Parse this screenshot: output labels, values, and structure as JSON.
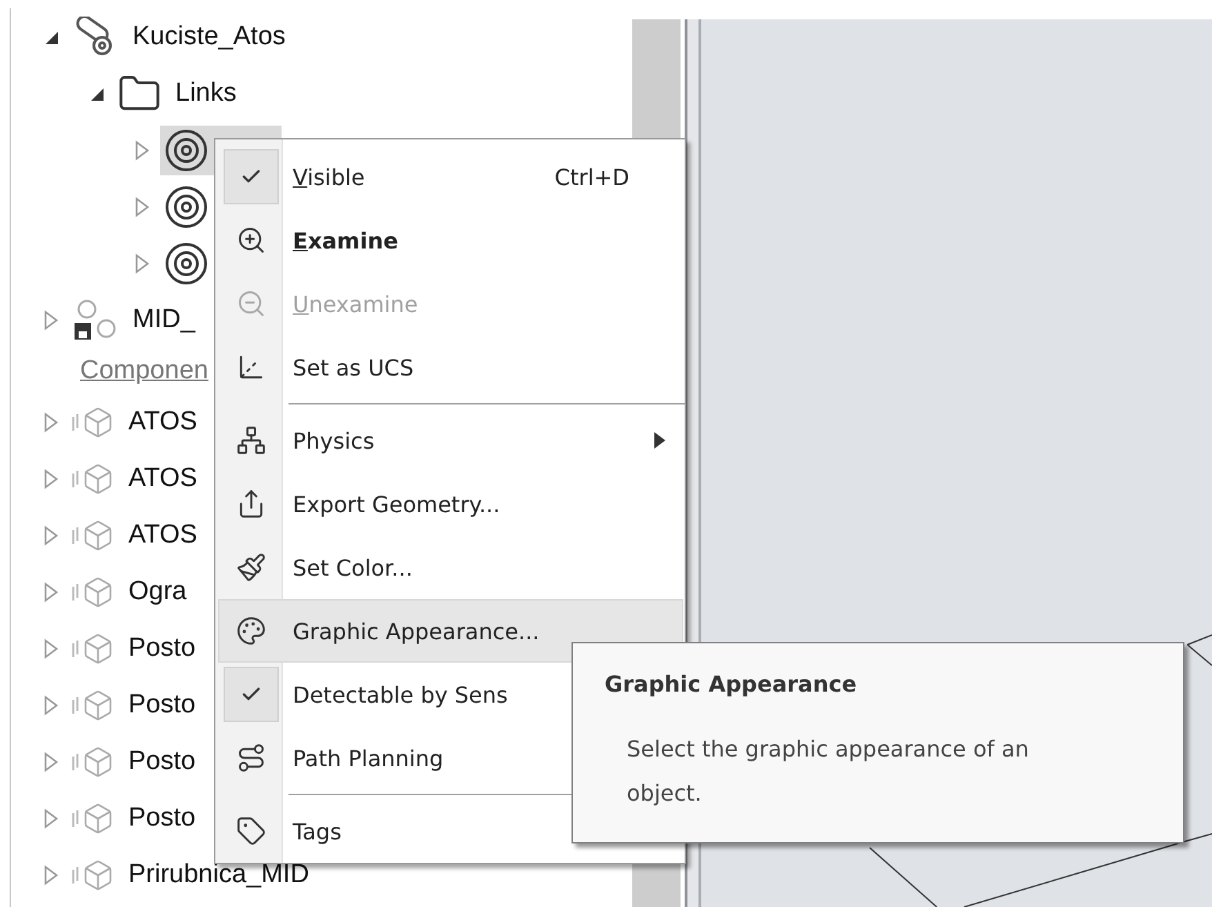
{
  "tree": [
    {
      "kind": "assembly",
      "label": "Kuciste_Atos",
      "expanded": true,
      "selected": false,
      "children": [
        {
          "kind": "folder",
          "label": "Links",
          "expanded": true,
          "selected": false,
          "children": [
            {
              "kind": "link",
              "expanded": false,
              "selected": true
            },
            {
              "kind": "link",
              "expanded": false,
              "selected": false
            },
            {
              "kind": "link",
              "expanded": false,
              "selected": false
            }
          ]
        }
      ]
    },
    {
      "kind": "saved-assembly",
      "label": "MID_",
      "expanded": false,
      "selected": false
    },
    {
      "kind": "caption",
      "label": "Componen"
    },
    {
      "kind": "component",
      "label": "ATOS",
      "expanded": false,
      "selected": false
    },
    {
      "kind": "component",
      "label": "ATOS",
      "expanded": false,
      "selected": false
    },
    {
      "kind": "component",
      "label": "ATOS",
      "expanded": false,
      "selected": false
    },
    {
      "kind": "component",
      "label": "Ogra",
      "expanded": false,
      "selected": false
    },
    {
      "kind": "component",
      "label": "Posto",
      "expanded": false,
      "selected": false
    },
    {
      "kind": "component",
      "label": "Posto",
      "expanded": false,
      "selected": false
    },
    {
      "kind": "component",
      "label": "Posto",
      "expanded": false,
      "selected": false
    },
    {
      "kind": "component",
      "label": "Posto",
      "expanded": false,
      "selected": false
    },
    {
      "kind": "component",
      "label": "Prirubnica_MID",
      "expanded": false,
      "selected": false
    }
  ],
  "context_menu": [
    {
      "kind": "check",
      "label": "Visible",
      "underline_first": true,
      "shortcut": "Ctrl+D",
      "checked": true,
      "disabled": false,
      "bold": false,
      "selected": false,
      "submenu": false
    },
    {
      "kind": "examine",
      "label": "Examine",
      "underline_first": true,
      "checked": false,
      "disabled": false,
      "bold": true,
      "selected": false,
      "submenu": false
    },
    {
      "kind": "unexamine",
      "label": "Unexamine",
      "underline_first": true,
      "checked": false,
      "disabled": true,
      "bold": false,
      "selected": false,
      "submenu": false
    },
    {
      "kind": "ucs",
      "label": "Set as UCS",
      "underline_first": false,
      "checked": false,
      "disabled": false,
      "bold": false,
      "selected": false,
      "submenu": false
    },
    {
      "kind": "separator"
    },
    {
      "kind": "physics",
      "label": "Physics",
      "underline_first": false,
      "checked": false,
      "disabled": false,
      "bold": false,
      "selected": false,
      "submenu": true
    },
    {
      "kind": "export",
      "label": "Export Geometry...",
      "underline_first": false,
      "checked": false,
      "disabled": false,
      "bold": false,
      "selected": false,
      "submenu": false
    },
    {
      "kind": "color",
      "label": "Set Color...",
      "underline_first": false,
      "checked": false,
      "disabled": false,
      "bold": false,
      "selected": false,
      "submenu": false
    },
    {
      "kind": "palette",
      "label": "Graphic Appearance...",
      "underline_first": false,
      "checked": false,
      "disabled": false,
      "bold": false,
      "selected": true,
      "submenu": false
    },
    {
      "kind": "check",
      "label": "Detectable by Sens",
      "underline_first": false,
      "checked": true,
      "disabled": false,
      "bold": false,
      "selected": false,
      "submenu": false
    },
    {
      "kind": "path",
      "label": "Path Planning",
      "underline_first": false,
      "checked": false,
      "disabled": false,
      "bold": false,
      "selected": false,
      "submenu": false
    },
    {
      "kind": "separator"
    },
    {
      "kind": "tag",
      "label": "Tags",
      "underline_first": false,
      "checked": false,
      "disabled": false,
      "bold": false,
      "selected": false,
      "submenu": false
    }
  ],
  "tooltip": {
    "title": "Graphic Appearance",
    "description": "Select the graphic appearance of an object."
  }
}
